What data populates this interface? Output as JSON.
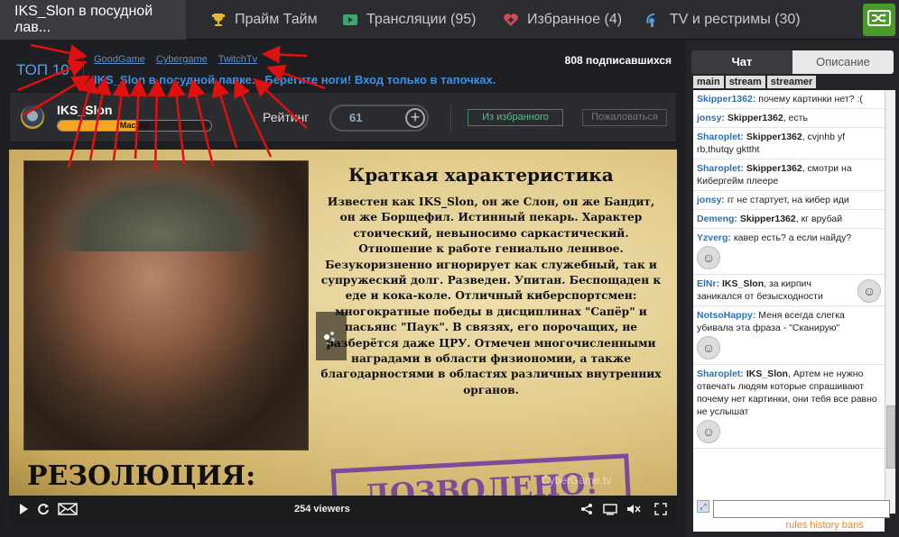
{
  "nav": {
    "active_tab": "IKS_Slon в посудной лав...",
    "tabs": [
      {
        "label": "Прайм Тайм",
        "icon": "trophy-icon"
      },
      {
        "label": "Трансляции (95)",
        "icon": "tv-play-icon"
      },
      {
        "label": "Избранное (4)",
        "icon": "heart-icon"
      },
      {
        "label": "TV и рестримы (30)",
        "icon": "satellite-icon"
      }
    ],
    "shuffle_icon": "shuffle-icon"
  },
  "header": {
    "top_label": "ТОП 10",
    "sources": [
      "GoodGame",
      "Cybergame",
      "TwitchTv"
    ],
    "subscribers": "808 подписавшихся",
    "stream_title": "IKS_Slon в посудной лавке... Берегите ноги! Вход только в тапочках."
  },
  "streamer": {
    "name": "IKS_Slon",
    "rank": "Мастер",
    "rank_progress_pct": 52,
    "rating_label": "Рейтинг",
    "rating_value": "61",
    "plus_label": "+",
    "fav_button": "Из избранного",
    "complain_button": "Пожаловаться"
  },
  "video": {
    "card_title": "Краткая характеристика",
    "card_text": "Известен как IKS_Slon, он же Слон, он же Бандит, он же Борщефил. Истинный пекарь. Характер стоический, невыносимо саркастический. Отношение к работе гениально ленивое. Безукоризненно игнорирует как служебный, так и супружеский долг. Разведен. Упитан. Беспощаден к еде и кока-коле. Отличный киберспортсмен: многократные победы в дисциплинах \"Сапёр\" и пасьянс \"Паук\". В связях, его порочащих, не разберётся даже ЦРУ. Отмечен многочисленными наградами в области физиономии, а также благодарностями в областях различных внутренних органов.",
    "card_bottom": "РЕЗОЛЮЦИЯ:",
    "stamp": "ДОЗВОЛЕНО!",
    "watermark": "CyberGame.tv",
    "viewers": "254 viewers"
  },
  "chat": {
    "tab_chat": "Чат",
    "tab_description": "Описание",
    "subtabs": [
      "main",
      "stream",
      "streamer"
    ],
    "messages": [
      {
        "nick": "Skipper1362:",
        "to": "",
        "text": "почему картинки нет? :("
      },
      {
        "nick": "jonsy:",
        "to": "Skipper1362",
        "text": ", есть"
      },
      {
        "nick": "Sharoplet:",
        "to": "Skipper1362",
        "text": ", cvjnhb yf rb,thutqy gkttht"
      },
      {
        "nick": "Sharoplet:",
        "to": "Skipper1362",
        "text": ", смотри на Кибергейм плеере"
      },
      {
        "nick": "jonsy:",
        "to": "",
        "text": "гг не стартует, на кибер иди"
      },
      {
        "nick": "Demeng:",
        "to": "Skipper1362",
        "text": ", кг врубай"
      },
      {
        "nick": "Yzverg:",
        "to": "",
        "text": "кавер есть? а если найду?",
        "face": true
      },
      {
        "nick": "ElNr:",
        "to": "IKS_Slon",
        "text": ", за кирпич",
        "face": true,
        "text2": "заникался от безысходности"
      },
      {
        "nick": "NotsoHappy:",
        "to": "",
        "text": "Меня всегда слегка убивала эта фраза - \"Сканирую\"",
        "face": true
      },
      {
        "nick": "Sharoplet:",
        "to": "IKS_Slon",
        "text": ", Артем не нужно отвечать людям которые спрашивают почему нет картинки, они тебя все равно не услышат",
        "face": true
      }
    ],
    "footer": {
      "chat": "chat",
      "img": "img",
      "col": "col",
      "smile": "smile",
      "rules": "rules",
      "history": "history",
      "bans": "bans"
    }
  }
}
